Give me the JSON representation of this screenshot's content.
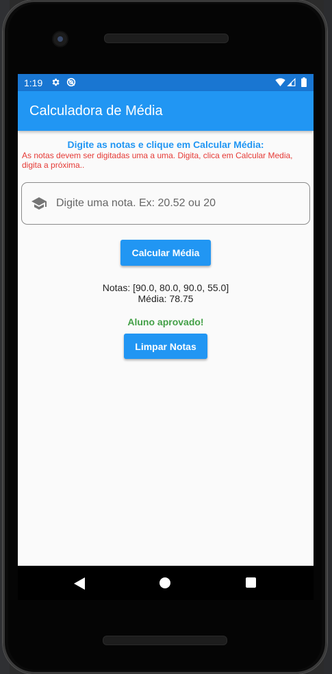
{
  "status_bar": {
    "time": "1:19",
    "icons": [
      "gear-icon",
      "sync-disabled-icon",
      "wifi-icon",
      "signal-icon",
      "battery-icon"
    ]
  },
  "app_bar": {
    "title": "Calculadora de Média",
    "color": "#2196f3"
  },
  "main": {
    "heading": "Digite as notas e clique em Calcular Média:",
    "instructions": "As notas devem ser digitadas uma a uma. Digita, clica em Calcular Media, digita a próxima..",
    "input": {
      "placeholder": "Digite uma nota. Ex: 20.52 ou 20",
      "value": "",
      "icon": "school-icon"
    },
    "calculate_button": "Calcular Média",
    "notes_line": "Notas: [90.0, 80.0, 90.0, 55.0]",
    "average_line": "Média: 78.75",
    "result": "Aluno aprovado!",
    "clear_button": "Limpar Notas"
  },
  "nav_bar": {
    "icons": [
      "back-icon",
      "home-icon",
      "recent-apps-icon"
    ]
  },
  "colors": {
    "primary": "#2196f3",
    "status_bar": "#1976d2",
    "error_text": "#e53935",
    "success_text": "#43a047"
  }
}
